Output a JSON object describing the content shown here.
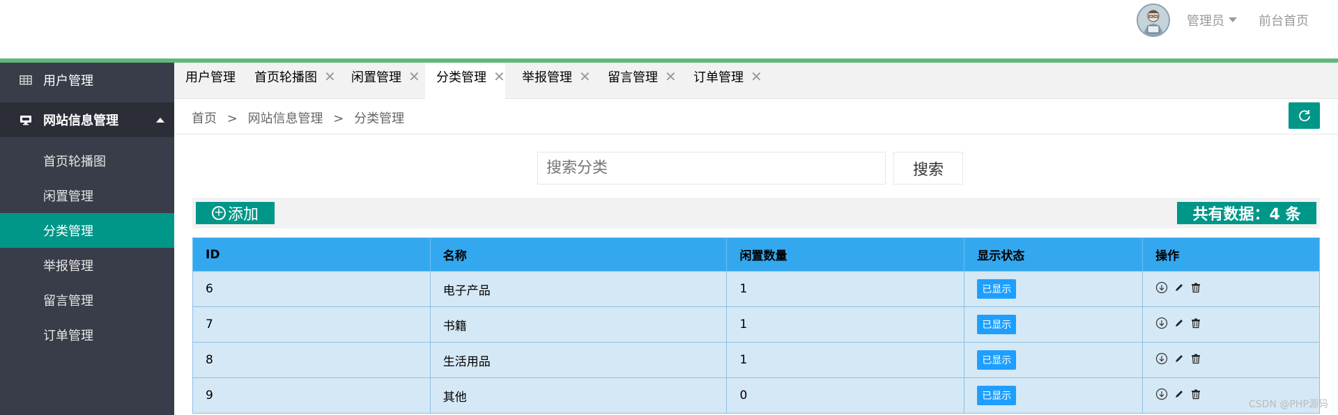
{
  "header": {
    "user_name": "管理员",
    "front_link": "前台首页"
  },
  "sidebar": {
    "items": [
      {
        "label": "用户管理",
        "icon": "table-icon"
      },
      {
        "label": "网站信息管理",
        "icon": "monitor-icon"
      }
    ],
    "sub_items": [
      "首页轮播图",
      "闲置管理",
      "分类管理",
      "举报管理",
      "留言管理",
      "订单管理"
    ],
    "active_sub": "分类管理"
  },
  "tabs": [
    "用户管理",
    "首页轮播图",
    "闲置管理",
    "分类管理",
    "举报管理",
    "留言管理",
    "订单管理"
  ],
  "active_tab": "分类管理",
  "breadcrumb": [
    "首页",
    "网站信息管理",
    "分类管理"
  ],
  "breadcrumb_sep": ">",
  "search": {
    "placeholder": "搜索分类",
    "button_label": "搜索"
  },
  "toolbar": {
    "add_label": "添加",
    "count_label": "共有数据：4 条"
  },
  "table": {
    "columns": [
      "ID",
      "名称",
      "闲置数量",
      "显示状态",
      "操作"
    ],
    "rows": [
      {
        "id": "6",
        "name": "电子产品",
        "count": "1",
        "status": "已显示"
      },
      {
        "id": "7",
        "name": "书籍",
        "count": "1",
        "status": "已显示"
      },
      {
        "id": "8",
        "name": "生活用品",
        "count": "1",
        "status": "已显示"
      },
      {
        "id": "9",
        "name": "其他",
        "count": "0",
        "status": "已显示"
      }
    ]
  },
  "watermark": "CSDN @PHP源码",
  "colors": {
    "accent": "#009688",
    "header_bar": "#5fb878",
    "sidebar_bg": "#393d49",
    "table_header": "#33a8ef",
    "table_row": "#d5e8f5",
    "status_badge": "#1e9fff"
  }
}
